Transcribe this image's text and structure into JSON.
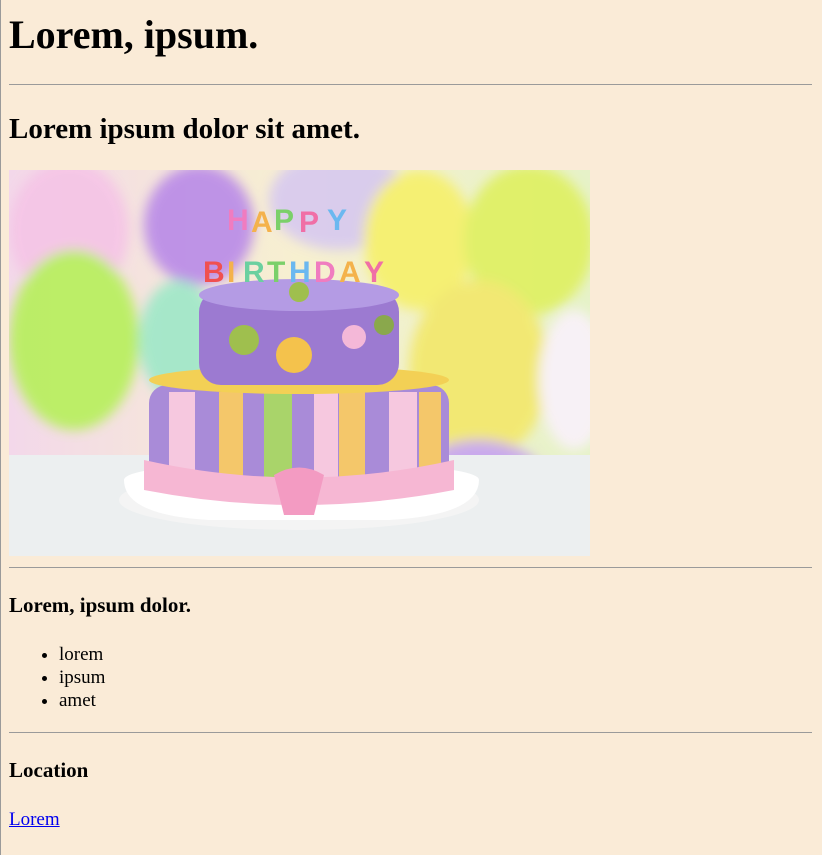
{
  "header": {
    "title": "Lorem, ipsum."
  },
  "section1": {
    "heading": "Lorem ipsum dolor sit amet.",
    "image": {
      "icon": "birthday-cake-icon",
      "caption_letters": "HAPPY BIRTHDAY"
    }
  },
  "section2": {
    "heading": "Lorem, ipsum dolor.",
    "items": [
      "lorem",
      "ipsum",
      "amet"
    ]
  },
  "section3": {
    "heading": "Location",
    "link": "Lorem"
  },
  "colors": {
    "background": "#faebd7",
    "link": "#0000ee",
    "rule": "#9a9a9a"
  }
}
